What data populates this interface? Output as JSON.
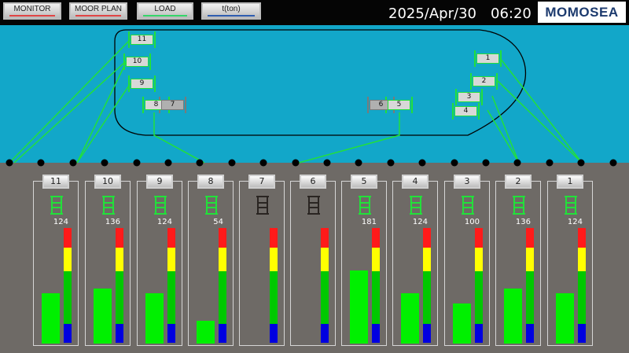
{
  "toolbar": {
    "buttons": [
      {
        "label": "MONITOR",
        "indicator_color": "#e04545"
      },
      {
        "label": "MOOR PLAN",
        "indicator_color": "#e04545"
      },
      {
        "label": "LOAD",
        "indicator_color": "#35d66a"
      },
      {
        "label": "t(ton)",
        "indicator_color": "#2f5db0"
      }
    ],
    "date": "2025/Apr/30",
    "time": "06:20",
    "logo": "MOMOSEA"
  },
  "colors": {
    "sea": "#12a7c9",
    "quay": "#6e6a66",
    "line_active": "#22e03a",
    "winch_inactive": "#7a7a7a",
    "scale": [
      "#ff1a1a",
      "#ffff00",
      "#00c800",
      "#0000e0"
    ]
  },
  "ship_winches": [
    {
      "label": "11",
      "active": true
    },
    {
      "label": "10",
      "active": true
    },
    {
      "label": "9",
      "active": true
    },
    {
      "label": "8",
      "active": true
    },
    {
      "label": "7",
      "active": false
    },
    {
      "label": "6",
      "active": false
    },
    {
      "label": "5",
      "active": true
    },
    {
      "label": "4",
      "active": true
    },
    {
      "label": "3",
      "active": true
    },
    {
      "label": "2",
      "active": true
    },
    {
      "label": "1",
      "active": true
    }
  ],
  "panels": [
    {
      "label": "11",
      "value": "124",
      "active": true,
      "load_fraction": 0.44
    },
    {
      "label": "10",
      "value": "136",
      "active": true,
      "load_fraction": 0.48
    },
    {
      "label": "9",
      "value": "124",
      "active": true,
      "load_fraction": 0.44
    },
    {
      "label": "8",
      "value": "54",
      "active": true,
      "load_fraction": 0.2
    },
    {
      "label": "7",
      "value": "",
      "active": false,
      "load_fraction": 0
    },
    {
      "label": "6",
      "value": "",
      "active": false,
      "load_fraction": 0
    },
    {
      "label": "5",
      "value": "181",
      "active": true,
      "load_fraction": 0.64
    },
    {
      "label": "4",
      "value": "124",
      "active": true,
      "load_fraction": 0.44
    },
    {
      "label": "3",
      "value": "100",
      "active": true,
      "load_fraction": 0.35
    },
    {
      "label": "2",
      "value": "136",
      "active": true,
      "load_fraction": 0.48
    },
    {
      "label": "1",
      "value": "124",
      "active": true,
      "load_fraction": 0.44
    }
  ]
}
